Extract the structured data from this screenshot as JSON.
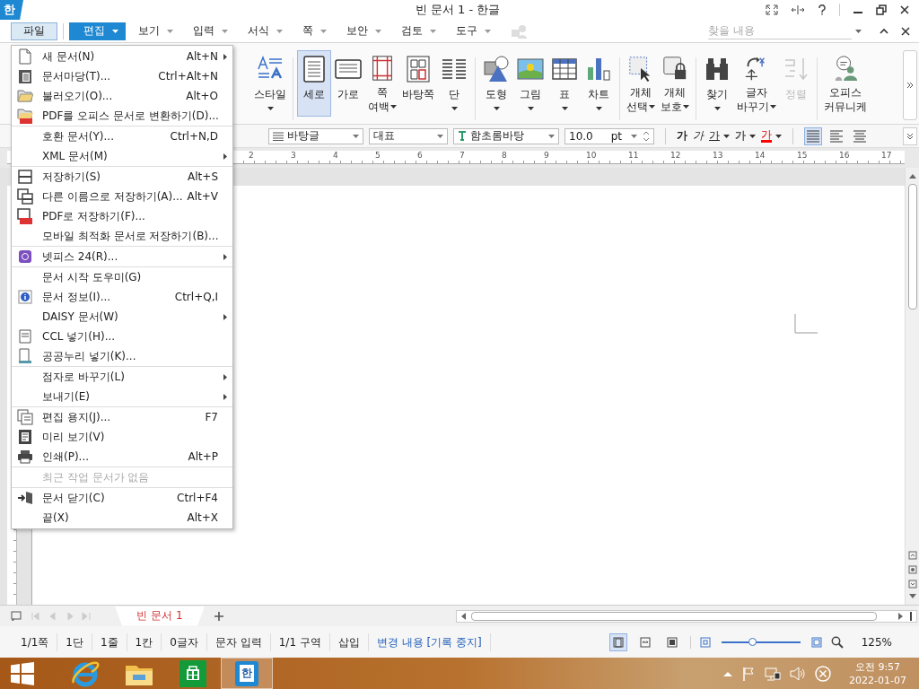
{
  "title_bar": {
    "app_logo": "한",
    "title": "빈 문서 1 - 한글"
  },
  "menu_bar": {
    "file_button": {
      "label": "파일",
      "open": true
    },
    "tabs": [
      {
        "label": "편집",
        "selected": true
      },
      {
        "label": "보기",
        "selected": false
      },
      {
        "label": "입력",
        "selected": false
      },
      {
        "label": "서식",
        "selected": false
      },
      {
        "label": "쪽",
        "selected": false
      },
      {
        "label": "보안",
        "selected": false
      },
      {
        "label": "검토",
        "selected": false
      },
      {
        "label": "도구",
        "selected": false
      }
    ],
    "search": {
      "placeholder": "찾을 내용"
    }
  },
  "ribbon": {
    "groups": [
      [
        {
          "lines": [
            "스타일"
          ],
          "dropdown": true,
          "selected": false,
          "disabled": false
        }
      ],
      [
        {
          "lines": [
            "세로"
          ],
          "dropdown": false,
          "selected": true,
          "disabled": false
        },
        {
          "lines": [
            "가로"
          ],
          "dropdown": false,
          "selected": false,
          "disabled": false
        },
        {
          "lines": [
            "쪽",
            "여백"
          ],
          "dropdown": true,
          "selected": false,
          "disabled": false
        },
        {
          "lines": [
            "바탕쪽"
          ],
          "dropdown": false,
          "selected": false,
          "disabled": false
        },
        {
          "lines": [
            "단"
          ],
          "dropdown": true,
          "selected": false,
          "disabled": false
        }
      ],
      [
        {
          "lines": [
            "도형"
          ],
          "dropdown": true,
          "selected": false,
          "disabled": false
        },
        {
          "lines": [
            "그림"
          ],
          "dropdown": true,
          "selected": false,
          "disabled": false
        },
        {
          "lines": [
            "표"
          ],
          "dropdown": true,
          "selected": false,
          "disabled": false
        },
        {
          "lines": [
            "차트"
          ],
          "dropdown": true,
          "selected": false,
          "disabled": false
        }
      ],
      [
        {
          "lines": [
            "개체",
            "선택"
          ],
          "dropdown": true,
          "selected": false,
          "disabled": false
        },
        {
          "lines": [
            "개체",
            "보호"
          ],
          "dropdown": true,
          "selected": false,
          "disabled": false
        }
      ],
      [
        {
          "lines": [
            "찾기"
          ],
          "dropdown": true,
          "selected": false,
          "disabled": false
        },
        {
          "lines": [
            "글자",
            "바꾸기"
          ],
          "dropdown": true,
          "selected": false,
          "disabled": false
        },
        {
          "lines": [
            "정렬"
          ],
          "dropdown": false,
          "selected": false,
          "disabled": true
        }
      ],
      [
        {
          "lines": [
            "오피스",
            "커뮤니케"
          ],
          "dropdown": false,
          "selected": false,
          "disabled": false
        }
      ]
    ]
  },
  "toolbar": {
    "style": "바탕글",
    "language": "대표",
    "font": "함초롬바탕",
    "size": "10.0",
    "unit": "pt",
    "format_buttons": [
      {
        "label": "가",
        "kind": "bold",
        "dropdown": false
      },
      {
        "label": "가",
        "kind": "italic",
        "dropdown": false
      },
      {
        "label": "가",
        "kind": "underline",
        "dropdown": true
      },
      {
        "label": "가",
        "kind": "outline",
        "dropdown": true
      },
      {
        "label": "가",
        "kind": "color",
        "dropdown": true,
        "color": "#ff0000"
      }
    ],
    "align_buttons": [
      {
        "selected": true
      },
      {
        "selected": false
      },
      {
        "selected": false
      }
    ]
  },
  "ruler": {
    "numbers": [
      "2",
      "3",
      "4",
      "5",
      "6",
      "7",
      "8",
      "9",
      "10",
      "11",
      "12",
      "13",
      "14",
      "15",
      "16",
      "17"
    ]
  },
  "file_menu": {
    "groups": [
      [
        {
          "label": "새 문서(N)",
          "shortcut": "Alt+N",
          "submenu": true,
          "disabled": false
        },
        {
          "label": "문서마당(T)...",
          "shortcut": "Ctrl+Alt+N",
          "submenu": false,
          "disabled": false
        },
        {
          "label": "불러오기(O)...",
          "shortcut": "Alt+O",
          "submenu": false,
          "disabled": false
        },
        {
          "label": "PDF를 오피스 문서로 변환하기(D)...",
          "submenu": false,
          "disabled": false
        }
      ],
      [
        {
          "label": "호환 문서(Y)...",
          "shortcut": "Ctrl+N,D",
          "submenu": false,
          "disabled": false
        },
        {
          "label": "XML 문서(M)",
          "submenu": true,
          "disabled": false
        }
      ],
      [
        {
          "label": "저장하기(S)",
          "shortcut": "Alt+S",
          "submenu": false,
          "disabled": false
        },
        {
          "label": "다른 이름으로 저장하기(A)...",
          "shortcut": "Alt+V",
          "submenu": false,
          "disabled": false
        },
        {
          "label": "PDF로 저장하기(F)...",
          "submenu": false,
          "disabled": false
        },
        {
          "label": "모바일 최적화 문서로 저장하기(B)...",
          "submenu": false,
          "disabled": false
        }
      ],
      [
        {
          "label": "넷피스 24(R)...",
          "submenu": true,
          "disabled": false
        }
      ],
      [
        {
          "label": "문서 시작 도우미(G)",
          "submenu": false,
          "disabled": false
        },
        {
          "label": "문서 정보(I)...",
          "shortcut": "Ctrl+Q,I",
          "submenu": false,
          "disabled": false
        },
        {
          "label": "DAISY 문서(W)",
          "submenu": true,
          "disabled": false
        },
        {
          "label": "CCL 넣기(H)...",
          "submenu": false,
          "disabled": false
        },
        {
          "label": "공공누리 넣기(K)...",
          "submenu": false,
          "disabled": false
        }
      ],
      [
        {
          "label": "점자로 바꾸기(L)",
          "submenu": true,
          "disabled": false
        },
        {
          "label": "보내기(E)",
          "submenu": true,
          "disabled": false
        }
      ],
      [
        {
          "label": "편집 용지(J)...",
          "shortcut": "F7",
          "submenu": false,
          "disabled": false
        },
        {
          "label": "미리 보기(V)",
          "submenu": false,
          "disabled": false
        },
        {
          "label": "인쇄(P)...",
          "shortcut": "Alt+P",
          "submenu": false,
          "disabled": false
        }
      ],
      [
        {
          "label": "최근 작업 문서가 없음",
          "submenu": false,
          "disabled": true
        }
      ],
      [
        {
          "label": "문서 닫기(C)",
          "shortcut": "Ctrl+F4",
          "submenu": false,
          "disabled": false
        },
        {
          "label": "끝(X)",
          "shortcut": "Alt+X",
          "submenu": false,
          "disabled": false
        }
      ]
    ]
  },
  "document_tabs": [
    {
      "label": "빈 문서 1",
      "selected": true
    }
  ],
  "status_bar": {
    "items": [
      "1/1쪽",
      "1단",
      "1줄",
      "1칸",
      "0글자",
      "문자 입력",
      "1/1 구역",
      "삽입"
    ],
    "track_changes": "변경 내용 [기록 중지]",
    "view_buttons": [
      {
        "selected": true
      },
      {
        "selected": false
      },
      {
        "selected": false
      }
    ],
    "zoom": {
      "level": 0.4,
      "reading": "125%"
    }
  },
  "taskbar": {
    "apps": [
      {
        "selected": false
      },
      {
        "selected": false
      },
      {
        "selected": false
      },
      {
        "selected": true,
        "label": "한"
      }
    ],
    "time": "오전 9:57",
    "date": "2022-01-07"
  }
}
